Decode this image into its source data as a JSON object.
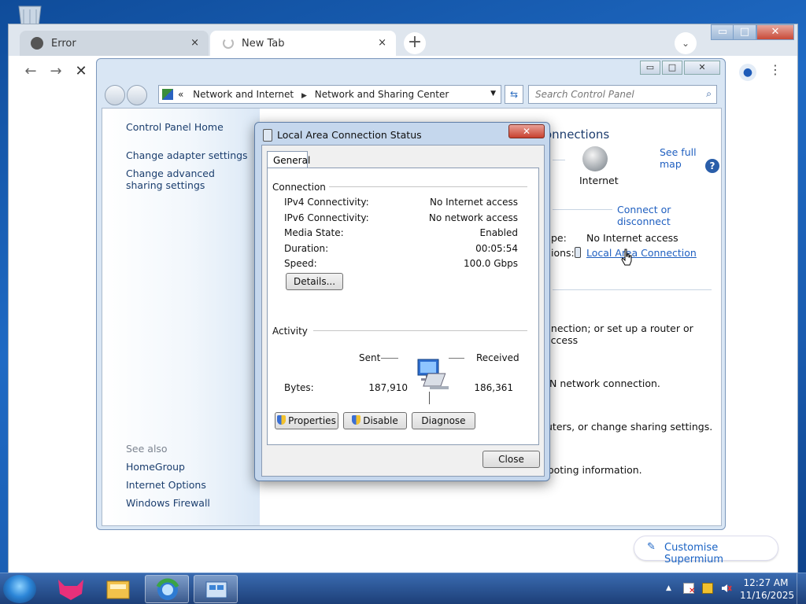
{
  "browser": {
    "tabs": [
      {
        "label": "Error",
        "close": "×"
      },
      {
        "label": "New Tab",
        "close": "×"
      }
    ],
    "new_tab": "+",
    "window_buttons": {
      "minimize": "▭",
      "maximize": "□",
      "close": "✕"
    },
    "customise_label": "Customise Supermium"
  },
  "control_panel": {
    "window_buttons": {
      "minimize": "▭",
      "maximize": "□",
      "close": "✕"
    },
    "breadcrumb": {
      "prefix": "«",
      "items": [
        "Network and Internet",
        "Network and Sharing Center"
      ]
    },
    "search_placeholder": "Search Control Panel",
    "left_nav": {
      "home": "Control Panel Home",
      "items": [
        "Change adapter settings",
        "Change advanced sharing settings"
      ],
      "see_also_heading": "See also",
      "see_also": [
        "HomeGroup",
        "Internet Options",
        "Windows Firewall"
      ]
    },
    "right": {
      "heading_fragment": "onnections",
      "see_full_map": "See full map",
      "internet_label": "Internet",
      "connect_or_disconnect": "Connect or disconnect",
      "access_type_fragment": "pe:",
      "access_type_value": "No Internet access",
      "connections_fragment": "ions:",
      "connection_link": "Local Area Connection",
      "task1": "nnection; or set up a router or access",
      "task2": "N network connection.",
      "task3": "uters, or change sharing settings.",
      "task4": "ooting information."
    }
  },
  "dialog": {
    "title": "Local Area Connection Status",
    "close": "✕",
    "tab": "General",
    "connection": {
      "heading": "Connection",
      "rows": [
        {
          "label": "IPv4 Connectivity:",
          "value": "No Internet access"
        },
        {
          "label": "IPv6 Connectivity:",
          "value": "No network access"
        },
        {
          "label": "Media State:",
          "value": "Enabled"
        },
        {
          "label": "Duration:",
          "value": "00:05:54"
        },
        {
          "label": "Speed:",
          "value": "100.0 Gbps"
        }
      ],
      "details_button": "Details..."
    },
    "activity": {
      "heading": "Activity",
      "sent_label": "Sent",
      "received_label": "Received",
      "bytes_label": "Bytes:",
      "bytes_sent": "187,910",
      "bytes_received": "186,361"
    },
    "buttons": {
      "properties": "Properties",
      "disable": "Disable",
      "diagnose": "Diagnose",
      "close": "Close"
    }
  },
  "taskbar": {
    "clock_time": "12:27 AM",
    "clock_date": "11/16/2025",
    "tray_arrow": "▲"
  }
}
